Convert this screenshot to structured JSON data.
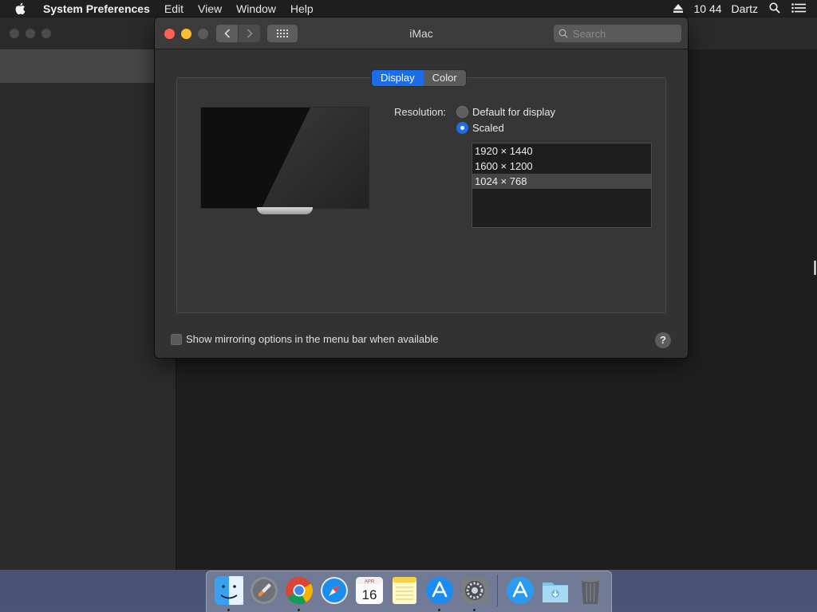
{
  "menubar": {
    "app_name": "System Preferences",
    "items": [
      "Edit",
      "View",
      "Window",
      "Help"
    ],
    "clock": "10 44",
    "user": "Dartz"
  },
  "window": {
    "title": "iMac",
    "search_placeholder": "Search",
    "tabs": [
      {
        "label": "Display",
        "active": true
      },
      {
        "label": "Color",
        "active": false
      }
    ],
    "resolution_label": "Resolution:",
    "radio_options": [
      {
        "label": "Default for display",
        "selected": false
      },
      {
        "label": "Scaled",
        "selected": true
      }
    ],
    "scaled_resolutions": [
      {
        "label": "1920 × 1440",
        "selected": false
      },
      {
        "label": "1600 × 1200",
        "selected": false
      },
      {
        "label": "1024 × 768",
        "selected": true
      }
    ],
    "mirroring_checkbox_label": "Show mirroring options in the menu bar when available",
    "mirroring_checked": false,
    "help_label": "?"
  },
  "dock": {
    "apps": [
      {
        "name": "finder-icon",
        "running": true
      },
      {
        "name": "launchpad-icon",
        "running": false
      },
      {
        "name": "chrome-icon",
        "running": true
      },
      {
        "name": "safari-icon",
        "running": false
      },
      {
        "name": "calendar-icon",
        "running": false,
        "month": "APR",
        "day": "16"
      },
      {
        "name": "notes-icon",
        "running": false
      },
      {
        "name": "app-store-icon",
        "running": true
      },
      {
        "name": "system-preferences-icon",
        "running": true
      }
    ],
    "others": [
      {
        "name": "app-store-download-icon"
      },
      {
        "name": "downloads-folder-icon"
      },
      {
        "name": "trash-icon"
      }
    ]
  },
  "colors": {
    "accent": "#1b6ee6",
    "close": "#fe5f57",
    "minimize": "#febc2e"
  }
}
